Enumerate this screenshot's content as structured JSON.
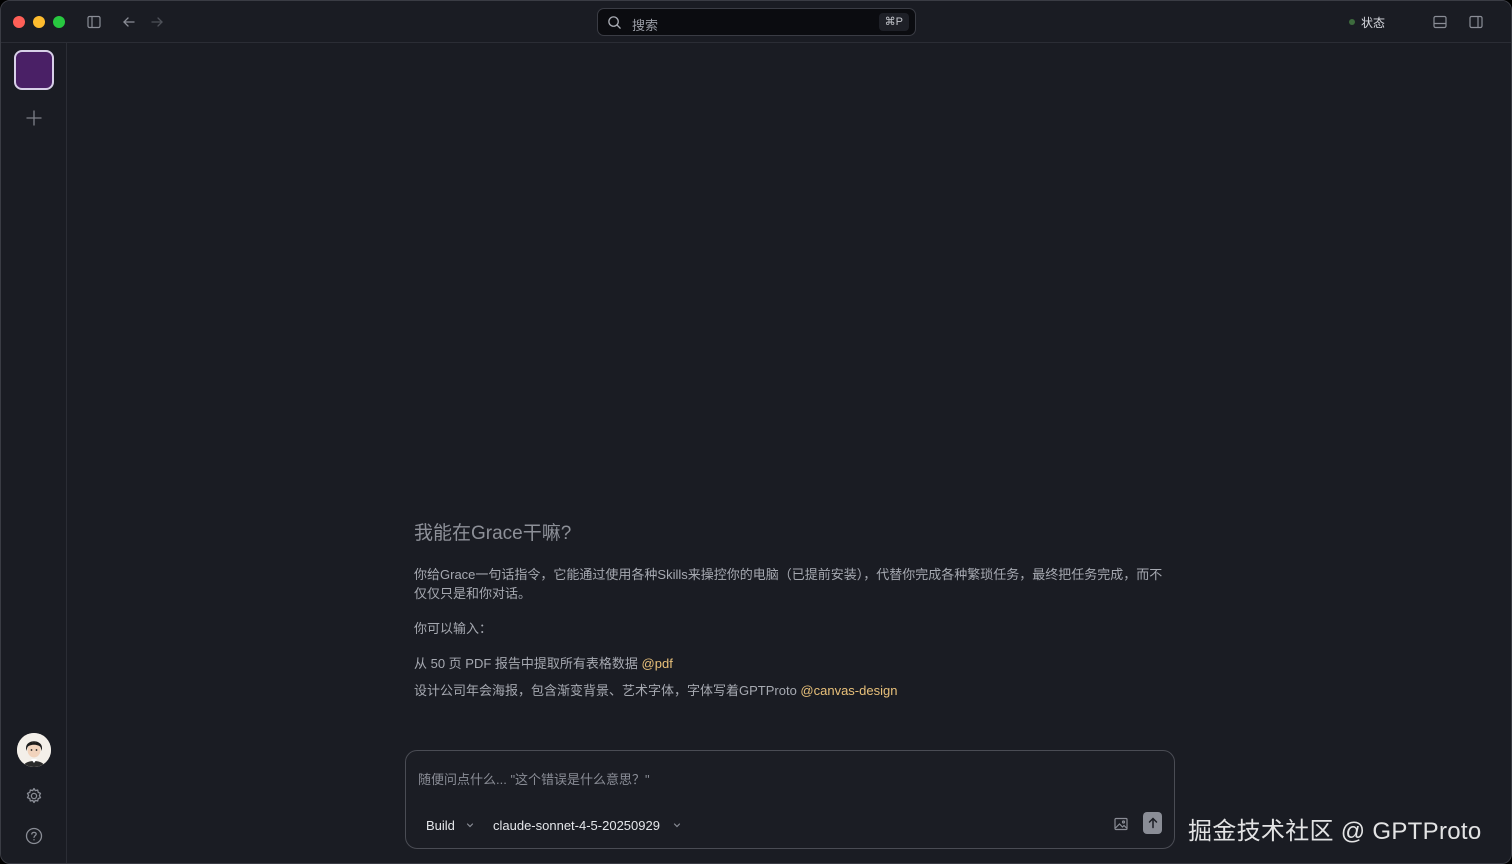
{
  "titlebar": {
    "search_placeholder": "搜索",
    "search_shortcut": "⌘P",
    "status_label": "状态",
    "status_color": "#3d6b3d"
  },
  "rail": {
    "workspace_color": "#4a2066",
    "icons": [
      "plus-icon",
      "gear-icon",
      "help-icon"
    ]
  },
  "intro": {
    "title": "我能在Grace干嘛?",
    "description": "你给Grace一句话指令，它能通过使用各种Skills来操控你的电脑（已提前安装），代替你完成各种繁琐任务，最终把任务完成，而不仅仅只是和你对话。",
    "prompt_label": "你可以输入：",
    "examples": [
      {
        "text": "从 50 页 PDF 报告中提取所有表格数据 ",
        "skill": "@pdf"
      },
      {
        "text": "设计公司年会海报，包含渐变背景、艺术字体，字体写着GPTProto ",
        "skill": "@canvas-design"
      }
    ],
    "skill_color": "#e8c07a"
  },
  "composer": {
    "placeholder": "随便问点什么... \"这个错误是什么意思？\"",
    "mode_label": "Build",
    "model_label": "claude-sonnet-4-5-20250929"
  },
  "watermark": "掘金技术社区 @ GPTProto"
}
